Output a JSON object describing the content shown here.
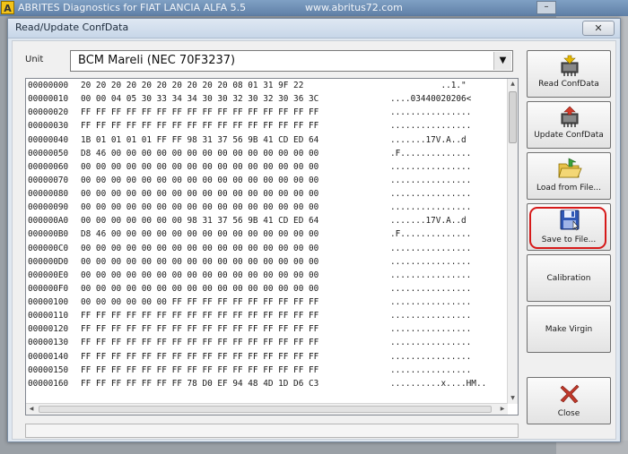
{
  "outer_window": {
    "app_icon_letter": "A",
    "title": "ABRITES Diagnostics for FIAT LANCIA ALFA 5.5",
    "url": "www.abritus72.com",
    "minimize_glyph": "–"
  },
  "dialog": {
    "title": "Read/Update ConfData",
    "close_glyph": "✕"
  },
  "unit": {
    "label": "Unit",
    "selected": "BCM Mareli (NEC 70F3237)"
  },
  "hex_rows": [
    {
      "addr": "00000000",
      "bytes": "20 20 20 20 20 20 20 20 20 20 08 01 31 9F 22",
      "ascii": "          ..1.\""
    },
    {
      "addr": "00000010",
      "bytes": "00 00 04 05 30 33 34 34 30 30 32 30 32 30 36 3C",
      "ascii": "....03440020206<"
    },
    {
      "addr": "00000020",
      "bytes": "FF FF FF FF FF FF FF FF FF FF FF FF FF FF FF FF",
      "ascii": "................"
    },
    {
      "addr": "00000030",
      "bytes": "FF FF FF FF FF FF FF FF FF FF FF FF FF FF FF FF",
      "ascii": "................"
    },
    {
      "addr": "00000040",
      "bytes": "1B 01 01 01 01 FF FF 98 31 37 56 9B 41 CD ED 64",
      "ascii": ".......17V.A..d"
    },
    {
      "addr": "00000050",
      "bytes": "D8 46 00 00 00 00 00 00 00 00 00 00 00 00 00 00",
      "ascii": ".F.............."
    },
    {
      "addr": "00000060",
      "bytes": "00 00 00 00 00 00 00 00 00 00 00 00 00 00 00 00",
      "ascii": "................"
    },
    {
      "addr": "00000070",
      "bytes": "00 00 00 00 00 00 00 00 00 00 00 00 00 00 00 00",
      "ascii": "................"
    },
    {
      "addr": "00000080",
      "bytes": "00 00 00 00 00 00 00 00 00 00 00 00 00 00 00 00",
      "ascii": "................"
    },
    {
      "addr": "00000090",
      "bytes": "00 00 00 00 00 00 00 00 00 00 00 00 00 00 00 00",
      "ascii": "................"
    },
    {
      "addr": "000000A0",
      "bytes": "00 00 00 00 00 00 00 98 31 37 56 9B 41 CD ED 64",
      "ascii": ".......17V.A..d"
    },
    {
      "addr": "000000B0",
      "bytes": "D8 46 00 00 00 00 00 00 00 00 00 00 00 00 00 00",
      "ascii": ".F.............."
    },
    {
      "addr": "000000C0",
      "bytes": "00 00 00 00 00 00 00 00 00 00 00 00 00 00 00 00",
      "ascii": "................"
    },
    {
      "addr": "000000D0",
      "bytes": "00 00 00 00 00 00 00 00 00 00 00 00 00 00 00 00",
      "ascii": "................"
    },
    {
      "addr": "000000E0",
      "bytes": "00 00 00 00 00 00 00 00 00 00 00 00 00 00 00 00",
      "ascii": "................"
    },
    {
      "addr": "000000F0",
      "bytes": "00 00 00 00 00 00 00 00 00 00 00 00 00 00 00 00",
      "ascii": "................"
    },
    {
      "addr": "00000100",
      "bytes": "00 00 00 00 00 00 FF FF FF FF FF FF FF FF FF FF",
      "ascii": "................"
    },
    {
      "addr": "00000110",
      "bytes": "FF FF FF FF FF FF FF FF FF FF FF FF FF FF FF FF",
      "ascii": "................"
    },
    {
      "addr": "00000120",
      "bytes": "FF FF FF FF FF FF FF FF FF FF FF FF FF FF FF FF",
      "ascii": "................"
    },
    {
      "addr": "00000130",
      "bytes": "FF FF FF FF FF FF FF FF FF FF FF FF FF FF FF FF",
      "ascii": "................"
    },
    {
      "addr": "00000140",
      "bytes": "FF FF FF FF FF FF FF FF FF FF FF FF FF FF FF FF",
      "ascii": "................"
    },
    {
      "addr": "00000150",
      "bytes": "FF FF FF FF FF FF FF FF FF FF FF FF FF FF FF FF",
      "ascii": "................"
    },
    {
      "addr": "00000160",
      "bytes": "FF FF FF FF FF FF FF 78 D0 EF 94 48 4D 1D D6 C3",
      "ascii": "..........x....HM.."
    }
  ],
  "buttons": {
    "read": "Read ConfData",
    "update": "Update ConfData",
    "load": "Load from File...",
    "save": "Save to File...",
    "calibration": "Calibration",
    "virgin": "Make Virgin",
    "close": "Close"
  },
  "icons": {
    "read": "chip-read-icon",
    "update": "chip-update-icon",
    "load": "folder-open-icon",
    "save": "floppy-disk-icon",
    "close": "red-x-icon"
  },
  "colors": {
    "highlight": "#d61a1a",
    "close_icon": "#c0392b"
  }
}
